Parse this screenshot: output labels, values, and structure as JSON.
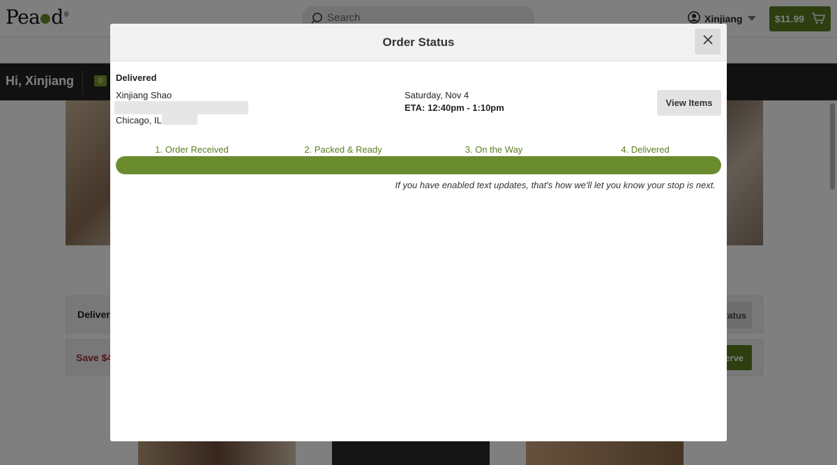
{
  "app": {
    "brand": "Peapod",
    "search_placeholder": "Search",
    "account_name": "Xinjiang",
    "cart_total": "$11.99"
  },
  "greeting": {
    "text": "Hi, Xinjiang",
    "badge": "0"
  },
  "background_rows": {
    "row1_label": "Delivere",
    "row1_button": "tatus",
    "row2_label": "Save $4",
    "row2_button": "erve"
  },
  "modal": {
    "title": "Order Status",
    "close_icon": "close-icon",
    "status": "Delivered",
    "customer_name": "Xinjiang Shao",
    "city": "Chicago, IL",
    "delivery_date": "Saturday, Nov 4",
    "eta": "ETA: 12:40pm - 1:10pm",
    "view_items_label": "View Items",
    "steps": [
      {
        "label": "1. Order Received"
      },
      {
        "label": "2. Packed & Ready"
      },
      {
        "label": "3. On the Way"
      },
      {
        "label": "4. Delivered"
      }
    ],
    "progress_fraction": 1.0,
    "note": "If you have enabled text updates, that's how we'll let you know your stop is next."
  },
  "colors": {
    "brand_green": "#5b7d1f",
    "progress_green": "#6a8c2f",
    "overlay": "rgba(0,0,0,0.5)"
  }
}
